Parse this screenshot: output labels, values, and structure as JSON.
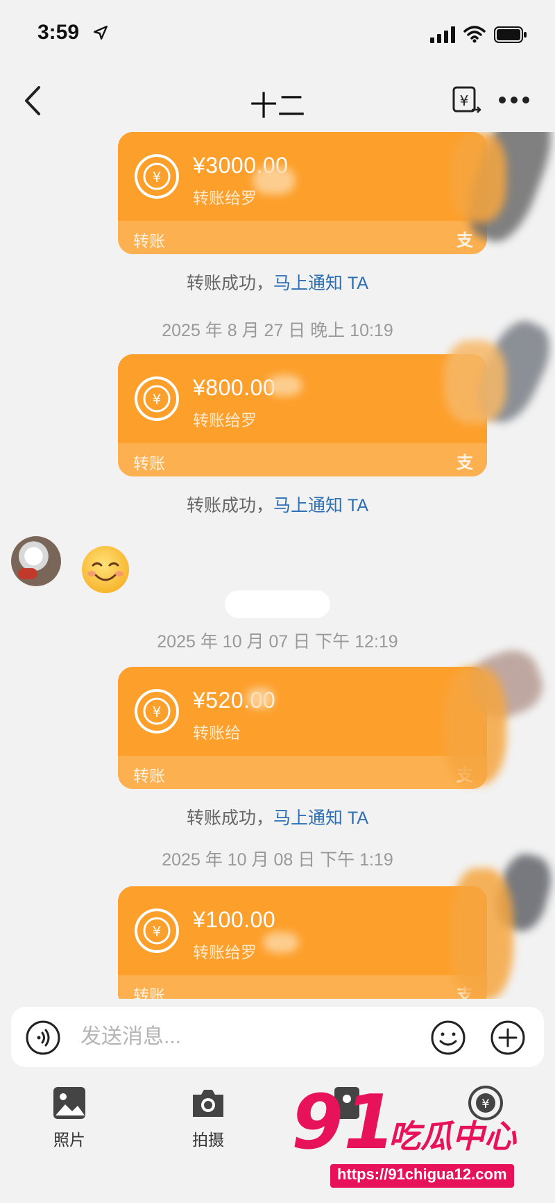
{
  "status_bar": {
    "time": "3:59"
  },
  "header": {
    "title": "十二"
  },
  "transfers": [
    {
      "amount": "¥3000.00",
      "to": "转账给罗",
      "type_label": "转账",
      "alipay_mark": "支"
    },
    {
      "amount": "¥800.00",
      "to": "转账给罗",
      "type_label": "转账",
      "alipay_mark": "支"
    },
    {
      "amount": "¥520.00",
      "to": "转账给",
      "type_label": "转账",
      "alipay_mark": "支"
    },
    {
      "amount": "¥100.00",
      "to": "转账给罗",
      "type_label": "转账",
      "alipay_mark": "支"
    }
  ],
  "status_msgs": {
    "success": "转账成功，",
    "notify_link": "马上通知 TA"
  },
  "timestamps": [
    "2025 年 8 月 27 日 晚上 10:19",
    "2025 年 10 月 07 日 下午 12:19",
    "2025 年 10 月 08 日 下午 1:19"
  ],
  "input": {
    "placeholder": "发送消息..."
  },
  "toolbar": {
    "photo": "照片",
    "camera": "拍摄"
  },
  "watermark": {
    "number": "91",
    "text": "吃瓜中心",
    "url": "https://91chigua12.com"
  },
  "colors": {
    "card_orange": "#fd9f2b",
    "card_footer": "#fdb04f",
    "link_blue": "#2d6fb5",
    "watermark_pink": "#e8125a"
  }
}
